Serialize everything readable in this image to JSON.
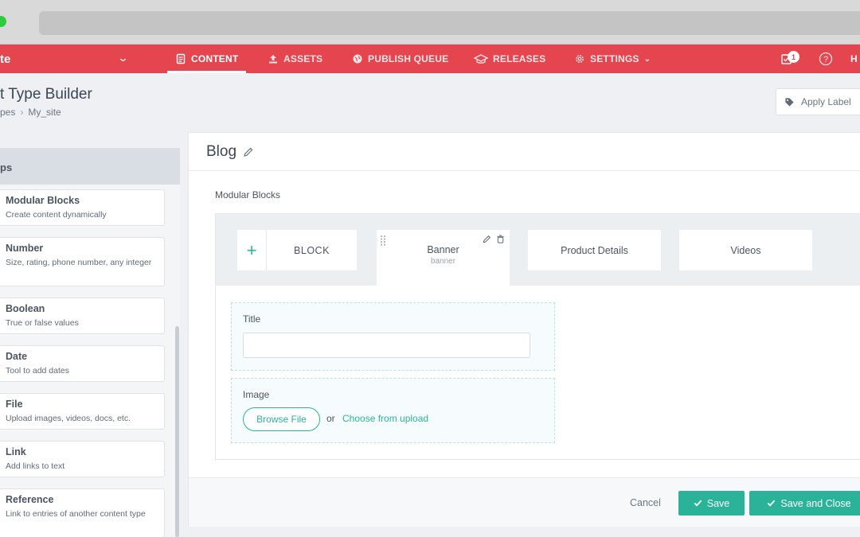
{
  "browser": {},
  "topnav": {
    "brand": "te",
    "items": [
      {
        "label": "CONTENT",
        "icon": "document-icon",
        "active": true
      },
      {
        "label": "ASSETS",
        "icon": "upload-icon"
      },
      {
        "label": "PUBLISH QUEUE",
        "icon": "globe-icon"
      },
      {
        "label": "RELEASES",
        "icon": "releases-icon"
      },
      {
        "label": "SETTINGS",
        "icon": "gear-icon"
      }
    ],
    "notification_count": "1",
    "user_initials": "H"
  },
  "header": {
    "title": "t Type Builder",
    "breadcrumb": [
      "pes",
      "My_site"
    ],
    "apply_label": "Apply Label"
  },
  "sidebar": {
    "title": "ps",
    "fields": [
      {
        "name": "Modular Blocks",
        "desc": "Create content dynamically"
      },
      {
        "name": "Number",
        "desc": "Size, rating, phone number, any integer"
      },
      {
        "name": "Boolean",
        "desc": "True or false values"
      },
      {
        "name": "Date",
        "desc": "Tool to add dates"
      },
      {
        "name": "File",
        "desc": "Upload images, videos, docs, etc."
      },
      {
        "name": "Link",
        "desc": "Add links to text"
      },
      {
        "name": "Reference",
        "desc": "Link to entries of another content type"
      }
    ]
  },
  "main": {
    "title": "Blog",
    "modular_blocks_label": "Modular Blocks",
    "add_block_label": "BLOCK",
    "blocks": [
      {
        "name": "Banner",
        "uid": "banner",
        "active": true
      },
      {
        "name": "Product Details"
      },
      {
        "name": "Videos"
      }
    ],
    "fields": {
      "title_label": "Title",
      "image_label": "Image",
      "browse_label": "Browse File",
      "or_text": "or",
      "choose_label": "Choose from upload"
    }
  },
  "footer": {
    "cancel_label": "Cancel",
    "save_label": "Save",
    "save_close_label": "Save and Close"
  },
  "colors": {
    "accent": "#e5454f",
    "action": "#2bb39a"
  }
}
